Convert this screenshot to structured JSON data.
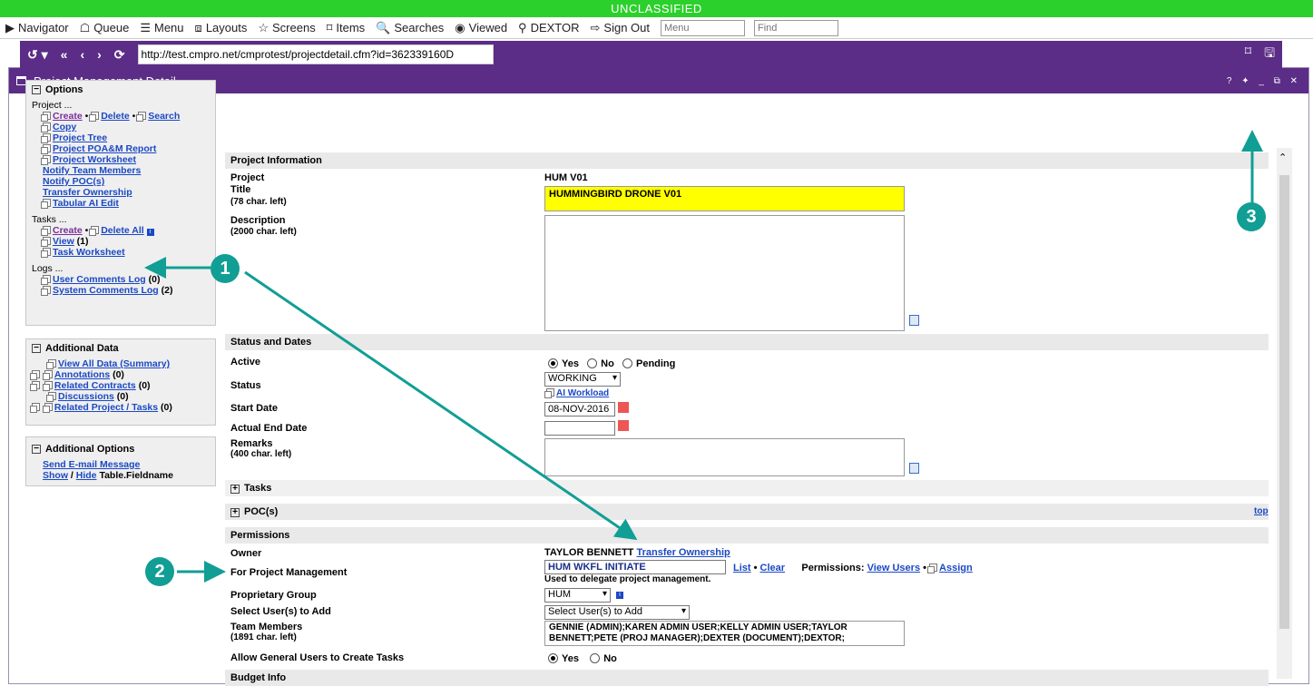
{
  "banner": "UNCLASSIFIED",
  "nav": {
    "items": [
      {
        "icon": "▶",
        "label": "Navigator"
      },
      {
        "icon": "☖",
        "label": "Queue"
      },
      {
        "icon": "☰",
        "label": "Menu"
      },
      {
        "icon": "⧈",
        "label": "Layouts"
      },
      {
        "icon": "☆",
        "label": "Screens"
      },
      {
        "icon": "⌑",
        "label": "Items"
      },
      {
        "icon": "🔍",
        "label": "Searches"
      },
      {
        "icon": "◉",
        "label": "Viewed"
      },
      {
        "icon": "⚲",
        "label": "DEXTOR"
      },
      {
        "icon": "⇨",
        "label": "Sign Out"
      }
    ],
    "menu_placeholder": "Menu",
    "find_placeholder": "Find"
  },
  "window": {
    "title": "Project Management Detail",
    "controls": "? ✦ _ ⧉ ✕"
  },
  "urlbar": {
    "url": "http://test.cmpro.net/cmprotest/projectdetail.cfm?id=362339160D"
  },
  "options": {
    "title": "Options",
    "project_label": "Project ...",
    "create": "Create",
    "delete": "Delete",
    "search": "Search",
    "copy": "Copy",
    "project_tree": "Project Tree",
    "poam_report": "Project POA&M Report",
    "worksheet": "Project Worksheet",
    "notify_team": "Notify Team Members",
    "notify_poc": "Notify POC(s)",
    "transfer": "Transfer Ownership",
    "tabular": "Tabular AI Edit",
    "tasks_label": "Tasks ...",
    "task_create": "Create",
    "task_delete_all": "Delete All",
    "task_view": "View",
    "task_view_count": "(1)",
    "task_worksheet": "Task Worksheet",
    "logs_label": "Logs ...",
    "user_log": "User Comments Log",
    "user_log_count": "(0)",
    "system_log": "System Comments Log",
    "system_log_count": "(2)"
  },
  "additional_data": {
    "title": "Additional Data",
    "view_all": "View All Data (Summary)",
    "annotations": "Annotations",
    "annotations_count": "(0)",
    "related_contracts": "Related Contracts",
    "related_contracts_count": "(0)",
    "discussions": "Discussions",
    "discussions_count": "(0)",
    "related_projects": "Related Project / Tasks",
    "related_projects_count": "(0)"
  },
  "additional_options": {
    "title": "Additional Options",
    "send_email": "Send E-mail Message",
    "show": "Show",
    "hide": "Hide",
    "table_fieldname": "Table.Fieldname"
  },
  "project_info": {
    "header": "Project Information",
    "project_label": "Project",
    "project_value": "HUM V01",
    "title_label": "Title",
    "title_sub": "(78 char. left)",
    "title_value": "HUMMINGBIRD DRONE V01",
    "desc_label": "Description",
    "desc_sub": "(2000 char. left)"
  },
  "status_dates": {
    "header": "Status and Dates",
    "active_label": "Active",
    "yes": "Yes",
    "no": "No",
    "pending": "Pending",
    "status_label": "Status",
    "status_value": "WORKING",
    "ai_workload": "AI Workload",
    "start_label": "Start Date",
    "start_value": "08-NOV-2016",
    "end_label": "Actual End Date",
    "remarks_label": "Remarks",
    "remarks_sub": "(400 char. left)"
  },
  "tasks_header": "Tasks",
  "poc_header": "POC(s)",
  "top_link": "top",
  "permissions": {
    "header": "Permissions",
    "owner_label": "Owner",
    "owner_value": "TAYLOR BENNETT",
    "transfer": "Transfer Ownership",
    "for_pm_label": "For Project Management",
    "for_pm_value": "HUM WKFL INITIATE",
    "list": "List",
    "clear": "Clear",
    "perm_label": "Permissions:",
    "view_users": "View Users",
    "assign": "Assign",
    "delegate_note": "Used to delegate project management.",
    "prop_group_label": "Proprietary Group",
    "prop_group_value": "HUM",
    "select_users_label": "Select User(s) to Add",
    "select_users_value": "Select User(s) to Add",
    "team_label": "Team Members",
    "team_sub": "(1891 char. left)",
    "team_value": "GENNIE (ADMIN);KAREN ADMIN USER;KELLY ADMIN USER;TAYLOR BENNETT;PETE (PROJ MANAGER);DEXTER (DOCUMENT);DEXTOR;",
    "allow_label": "Allow General Users to Create Tasks",
    "yes": "Yes",
    "no": "No"
  },
  "budget_header": "Budget Info",
  "callouts": {
    "c1": "1",
    "c2": "2",
    "c3": "3"
  },
  "colors": {
    "banner": "#2cd02c",
    "header": "#5b2d86",
    "callout": "#119e94",
    "highlight": "#ffff00"
  }
}
